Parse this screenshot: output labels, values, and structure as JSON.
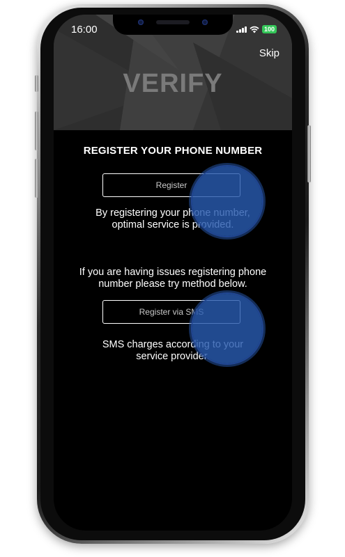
{
  "status_bar": {
    "time": "16:00",
    "battery": "100",
    "icons": [
      "signal-icon",
      "wifi-icon",
      "battery-icon"
    ]
  },
  "header": {
    "skip_label": "Skip",
    "logo_text": "VERIFY"
  },
  "main": {
    "title": "REGISTER YOUR PHONE NUMBER",
    "register_button": "Register",
    "register_note_line1": "By registering your phone number,",
    "register_note_line2": "optimal service is provided.",
    "issues_line1": "If you are having issues registering phone",
    "issues_line2": "number please try method below.",
    "sms_button": "Register via SMS",
    "sms_note_line1": "SMS charges according to your",
    "sms_note_line2": "service provider."
  },
  "colors": {
    "background": "#000000",
    "header": "#3a3a3a",
    "logo": "#7a7a7a",
    "battery": "#34c759",
    "touch_indicator": "#285aaf"
  }
}
